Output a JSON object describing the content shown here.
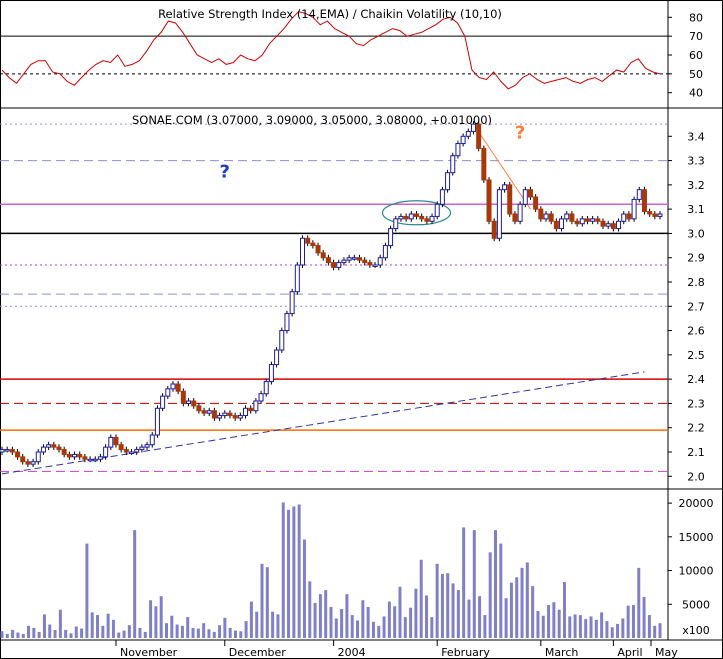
{
  "chart_data": [
    {
      "panel": "indicator",
      "type": "line",
      "title": "Relative Strength Index (14,EMA) / Chaikin Volatility (10,10)",
      "y_ticks": [
        40,
        50,
        60,
        70,
        80
      ],
      "ylim": [
        34,
        86
      ],
      "reference_lines": [
        70,
        50
      ],
      "series_color": "#d00000",
      "series": [
        {
          "values": [
            52,
            48,
            45,
            50,
            55,
            57,
            57,
            51,
            50,
            46,
            44,
            48,
            52,
            55,
            57,
            56,
            60,
            54,
            55,
            57,
            62,
            68,
            72,
            78,
            77,
            72,
            66,
            60,
            58,
            56,
            58,
            55,
            56,
            60,
            58,
            57,
            60,
            66,
            70,
            74,
            79,
            83,
            82,
            80,
            76,
            78,
            74,
            72,
            70,
            66,
            65,
            68,
            70,
            72,
            74,
            73,
            70,
            71,
            72,
            74,
            76,
            79,
            80,
            77,
            70,
            52,
            48,
            47,
            51,
            46,
            42,
            44,
            48,
            50,
            47,
            45,
            46,
            47,
            48,
            46,
            45,
            47,
            48,
            46,
            49,
            52,
            51,
            56,
            58,
            53,
            51,
            50
          ]
        }
      ]
    },
    {
      "panel": "price",
      "type": "candlestick",
      "title": "SONAE.COM (3.07000, 3.09000, 3.05000, 3.08000, +0.01000)",
      "x_tick_labels": [
        "November",
        "December",
        "2004",
        "February",
        "March",
        "April",
        "May"
      ],
      "y_ticks": [
        2.0,
        2.1,
        2.2,
        2.3,
        2.4,
        2.5,
        2.6,
        2.7,
        2.8,
        2.9,
        3.0,
        3.1,
        3.2,
        3.3,
        3.4
      ],
      "ylim": [
        1.96,
        3.5
      ],
      "up_color": "#1c1c9c",
      "down_color": "#a83808",
      "closes": [
        2.11,
        2.11,
        2.1,
        2.08,
        2.06,
        2.05,
        2.06,
        2.1,
        2.12,
        2.13,
        2.12,
        2.11,
        2.09,
        2.08,
        2.09,
        2.08,
        2.07,
        2.07,
        2.07,
        2.08,
        2.12,
        2.16,
        2.13,
        2.11,
        2.1,
        2.1,
        2.11,
        2.12,
        2.13,
        2.17,
        2.28,
        2.33,
        2.36,
        2.38,
        2.35,
        2.3,
        2.31,
        2.29,
        2.27,
        2.26,
        2.27,
        2.24,
        2.25,
        2.26,
        2.25,
        2.24,
        2.25,
        2.28,
        2.27,
        2.31,
        2.34,
        2.39,
        2.46,
        2.52,
        2.6,
        2.67,
        2.76,
        2.87,
        2.98,
        2.96,
        2.95,
        2.92,
        2.9,
        2.88,
        2.86,
        2.88,
        2.89,
        2.9,
        2.9,
        2.89,
        2.88,
        2.87,
        2.87,
        2.9,
        2.95,
        3.02,
        3.06,
        3.07,
        3.06,
        3.08,
        3.07,
        3.06,
        3.05,
        3.07,
        3.12,
        3.18,
        3.25,
        3.32,
        3.37,
        3.4,
        3.42,
        3.45,
        3.35,
        3.22,
        3.05,
        2.98,
        3.18,
        3.2,
        3.08,
        3.05,
        3.12,
        3.18,
        3.15,
        3.1,
        3.06,
        3.08,
        3.05,
        3.02,
        3.06,
        3.08,
        3.05,
        3.04,
        3.06,
        3.05,
        3.06,
        3.05,
        3.03,
        3.04,
        3.02,
        3.05,
        3.08,
        3.06,
        3.14,
        3.18,
        3.09,
        3.08,
        3.07,
        3.08
      ],
      "horizontal_levels": [
        {
          "value": 3.45,
          "style": "dotted",
          "color": "#9090d8"
        },
        {
          "value": 3.3,
          "style": "dashed",
          "color": "#9090c8"
        },
        {
          "value": 3.12,
          "style": "solid",
          "color": "#d060d0"
        },
        {
          "value": 3.0,
          "style": "solid",
          "color": "#000000"
        },
        {
          "value": 2.87,
          "style": "dotted",
          "color": "#c040c0"
        },
        {
          "value": 2.75,
          "style": "dashed",
          "color": "#9090c8"
        },
        {
          "value": 2.7,
          "style": "dotted",
          "color": "#9090d8"
        },
        {
          "value": 2.4,
          "style": "solid",
          "color": "#d80000"
        },
        {
          "value": 2.3,
          "style": "dashed",
          "color": "#c00000"
        },
        {
          "value": 2.19,
          "style": "solid",
          "color": "#ff6a00"
        },
        {
          "value": 2.02,
          "style": "dashed",
          "color": "#c040c0"
        }
      ],
      "trendline_rising": {
        "from": [
          0,
          2.01
        ],
        "to": [
          124,
          2.43
        ]
      },
      "trendline_falling": {
        "from": [
          91,
          3.45
        ],
        "to": [
          102,
          3.1
        ]
      },
      "annotations": [
        {
          "text": "?",
          "color": "#1f3fc0",
          "at": [
            43,
            3.23
          ]
        },
        {
          "text": "?",
          "color": "#ff7f3f",
          "at": [
            100,
            3.39
          ]
        }
      ]
    },
    {
      "panel": "volume",
      "type": "bar",
      "y_ticks": [
        5000,
        10000,
        15000,
        20000
      ],
      "ylim": [
        0,
        21500
      ],
      "unit_label": "x100",
      "bar_color": "#8080c8",
      "values": [
        1000,
        600,
        1200,
        800,
        600,
        1800,
        1500,
        900,
        3500,
        2000,
        1200,
        4200,
        1200,
        700,
        1700,
        1400,
        14000,
        3800,
        3400,
        1800,
        3600,
        2700,
        800,
        1100,
        1900,
        16000,
        1500,
        900,
        5600,
        4700,
        6200,
        2200,
        3300,
        2000,
        1800,
        3100,
        1500,
        1400,
        2200,
        1300,
        900,
        1900,
        3000,
        1500,
        1100,
        1000,
        2500,
        5400,
        3900,
        11000,
        10500,
        3900,
        3500,
        20100,
        19000,
        19500,
        19800,
        14600,
        8400,
        5200,
        6500,
        7100,
        4600,
        2900,
        4300,
        6500,
        3400,
        2600,
        5600,
        4600,
        2400,
        1800,
        3200,
        5400,
        4700,
        7600,
        3100,
        4500,
        7300,
        11600,
        6300,
        3100,
        11000,
        9500,
        9600,
        8100,
        7100,
        16400,
        5700,
        16000,
        6200,
        3400,
        12700,
        16000,
        14000,
        5900,
        8200,
        9000,
        10400,
        11200,
        7700,
        4000,
        3300,
        4900,
        5300,
        4200,
        8300,
        3200,
        3500,
        3400,
        2800,
        3200,
        2700,
        3800,
        2500,
        1600,
        2100,
        2900,
        4800,
        4900,
        10400,
        6100,
        3400,
        1800,
        2200
      ]
    }
  ]
}
